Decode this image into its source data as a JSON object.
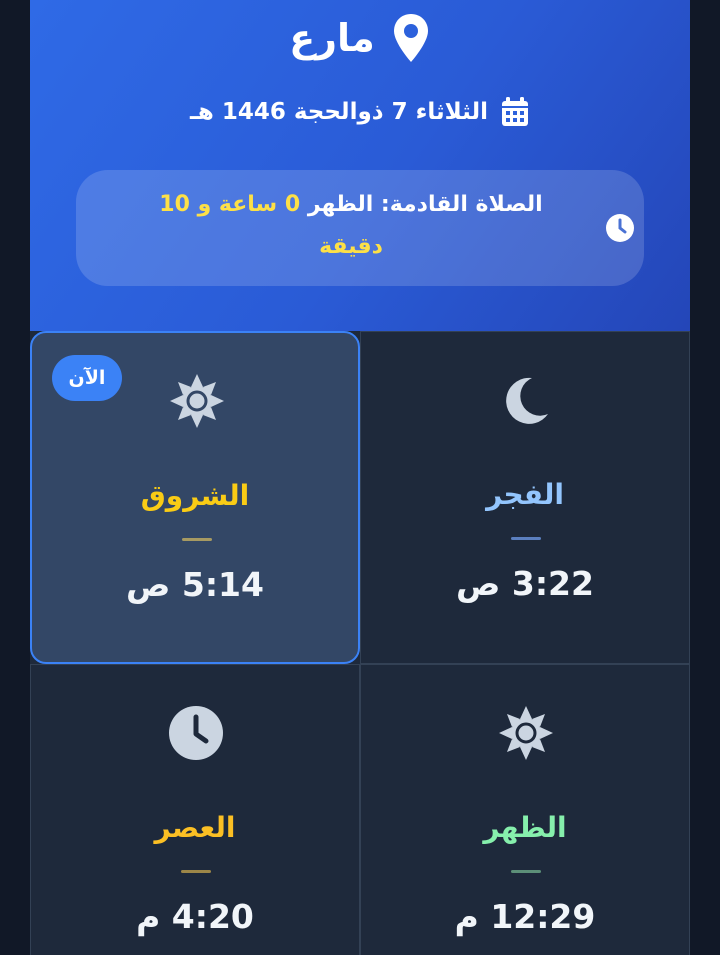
{
  "header": {
    "city": "مارع",
    "date": "الثلاثاء 7 ذوالحجة 1446 هـ",
    "next_prayer": {
      "prefix": "الصلاة القادمة: الظهر ",
      "hours": "0",
      "hours_word": " ساعة و ",
      "minutes": "10",
      "minutes_word": "دقيقة"
    }
  },
  "prayers": [
    {
      "name": "الشروق",
      "time": "5:14 ص",
      "icon": "sun-icon",
      "color": "#facc15",
      "bar_color": "#a79a62",
      "current": true,
      "badge": "الآن"
    },
    {
      "name": "الفجر",
      "time": "3:22 ص",
      "icon": "moon-icon",
      "color": "#93c5fd",
      "bar_color": "#5b7fbf",
      "current": false
    },
    {
      "name": "العصر",
      "time": "4:20 م",
      "icon": "clock-icon",
      "color": "#fbbf24",
      "bar_color": "#9c8648",
      "current": false
    },
    {
      "name": "الظهر",
      "time": "12:29 م",
      "icon": "sun-icon",
      "color": "#86efac",
      "bar_color": "#5c8f78",
      "current": false
    }
  ],
  "colors": {
    "header_gradient_start": "#2f6ae6",
    "header_gradient_end": "#2446b8",
    "card_background": "#1e293b",
    "active_card_background": "#334766",
    "accent": "#3b82f6",
    "highlight": "#fde047"
  }
}
